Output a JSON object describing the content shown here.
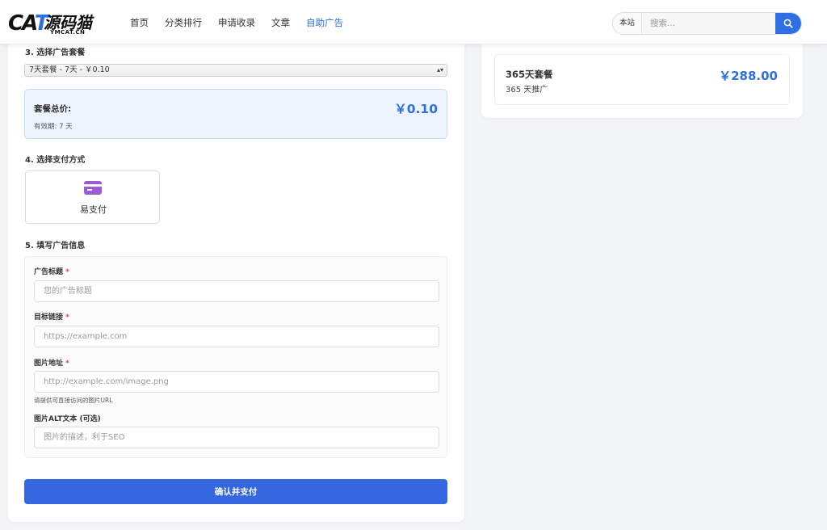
{
  "logo": {
    "mark_left": "CA",
    "mark_a": "T",
    "cn_text": "源码猫",
    "sub_text": "YMCAT.CN"
  },
  "nav": {
    "items": [
      {
        "label": "首页"
      },
      {
        "label": "分类排行"
      },
      {
        "label": "申请收录"
      },
      {
        "label": "文章"
      },
      {
        "label": "自助广告"
      }
    ],
    "active_index": 4
  },
  "search": {
    "scope": "本站",
    "placeholder": "搜索..."
  },
  "colors": {
    "accent": "#2f6fe4",
    "pay_icon": "#9b5bd9",
    "required": "#e53e3e",
    "total_bg": "#eef4fd"
  },
  "main": {
    "package_section": {
      "title": "3. 选择广告套餐",
      "selected": "7天套餐 - 7天 - ￥0.10"
    },
    "total": {
      "label": "套餐总价:",
      "price": "￥0.10",
      "validity": "有效期: 7 天"
    },
    "payment_section": {
      "title": "4. 选择支付方式",
      "method_label": "易支付",
      "method_icon": "credit-card-icon"
    },
    "ad_info_section": {
      "title": "5. 填写广告信息",
      "fields": [
        {
          "label": "广告标题",
          "required_mark": "*",
          "placeholder": "您的广告标题",
          "value": ""
        },
        {
          "label": "目标链接",
          "required_mark": "*",
          "placeholder": "https://example.com",
          "value": ""
        },
        {
          "label": "图片地址",
          "required_mark": "*",
          "placeholder": "http://example.com/image.png",
          "value": "",
          "hint": "请提供可直接访问的图片URL"
        },
        {
          "label": "图片ALT文本 (可选)",
          "placeholder": "图片的描述，利于SEO",
          "value": ""
        }
      ]
    },
    "submit_label": "确认并支付"
  },
  "sidebar": {
    "plan": {
      "name": "365天套餐",
      "desc": "365 天推广",
      "price": "￥288.00"
    }
  }
}
